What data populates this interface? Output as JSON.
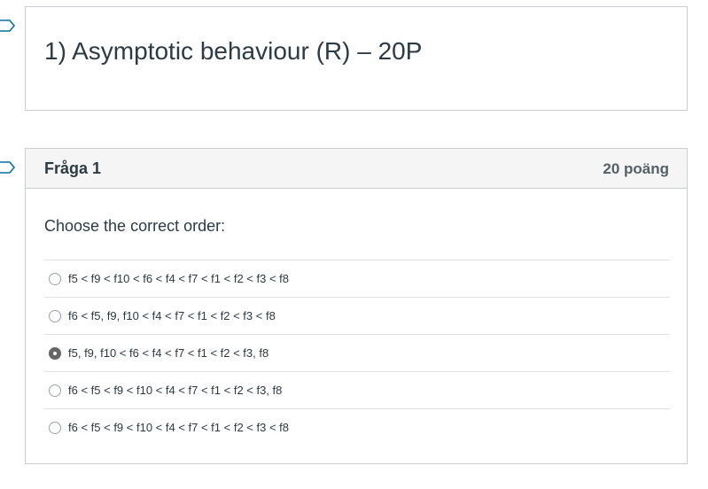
{
  "section": {
    "title": "1) Asymptotic behaviour (R) – 20P"
  },
  "question": {
    "name": "Fråga 1",
    "points": "20 poäng",
    "prompt": "Choose the correct order:",
    "answers": [
      {
        "label": "f5 < f9 < f10 < f6 < f4 < f7 < f1 < f2 < f3 < f8",
        "selected": false
      },
      {
        "label": "f6 < f5, f9, f10 < f4 < f7 < f1 < f2 < f3 < f8",
        "selected": false
      },
      {
        "label": "f5, f9, f10 < f6 < f4 < f7 < f1 < f2 < f3, f8",
        "selected": true
      },
      {
        "label": "f6 < f5 < f9 < f10 < f4 < f7 < f1 < f2 < f3, f8",
        "selected": false
      },
      {
        "label": "f6 < f5 < f9 < f10 < f4 < f7 < f1 < f2 < f3 < f8",
        "selected": false
      }
    ]
  },
  "colors": {
    "border": "#c7cdd1",
    "header_bg": "#f5f5f5",
    "flag_outline": "#0770a3"
  }
}
